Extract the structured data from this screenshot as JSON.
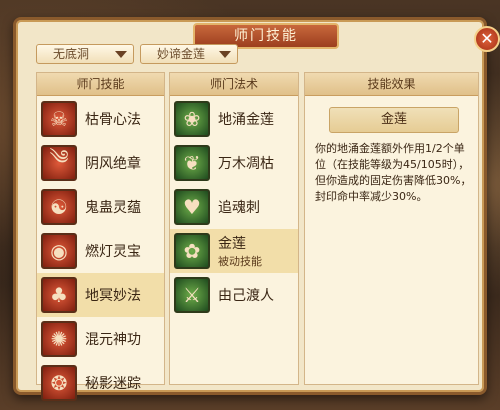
{
  "dialog": {
    "title": "师门技能",
    "close_symbol": "✕"
  },
  "filters": {
    "sect": "无底洞",
    "skill": "妙谛金莲"
  },
  "columns": {
    "sect_skills": {
      "header": "师门技能"
    },
    "spells": {
      "header": "师门法术"
    },
    "effect": {
      "header": "技能效果"
    }
  },
  "sect_skills": [
    {
      "label": "枯骨心法",
      "icon": "skull-icon"
    },
    {
      "label": "阴风绝章",
      "icon": "wind-scroll-icon"
    },
    {
      "label": "鬼蛊灵蕴",
      "icon": "ghost-icon"
    },
    {
      "label": "燃灯灵宝",
      "icon": "lamp-treasure-icon"
    },
    {
      "label": "地冥妙法",
      "icon": "tree-icon",
      "selected": true
    },
    {
      "label": "混元神功",
      "icon": "chaos-icon"
    },
    {
      "label": "秘影迷踪",
      "icon": "shadow-icon"
    }
  ],
  "spells": [
    {
      "label": "地涌金莲",
      "icon": "lotus-icon"
    },
    {
      "label": "万木凋枯",
      "icon": "withered-tree-icon"
    },
    {
      "label": "追魂刺",
      "icon": "heart-pierce-icon"
    },
    {
      "label": "金莲",
      "sub": "被动技能",
      "icon": "golden-lotus-icon",
      "selected": true
    },
    {
      "label": "由己渡人",
      "icon": "sword-icon"
    }
  ],
  "effect": {
    "name": "金莲",
    "description": "你的地涌金莲额外作用1/2个单位（在技能等级为45/105时），但你造成的固定伤害降低30%，封印命中率减少30%。"
  },
  "colors": {
    "frame": "#8a5a2c",
    "panel": "#f2e6c8",
    "accent": "#c8683c"
  }
}
